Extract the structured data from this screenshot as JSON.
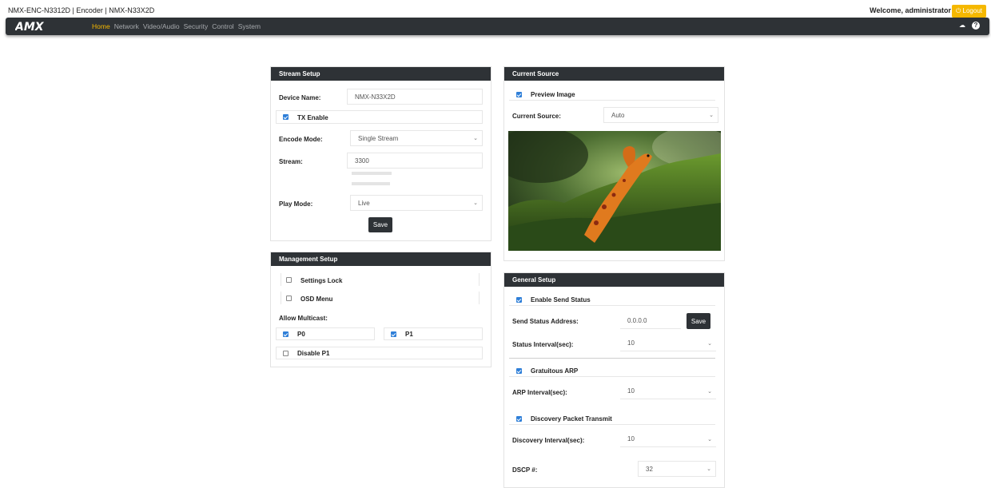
{
  "header": {
    "device_title": "NMX-ENC-N3312D | Encoder | NMX-N33X2D",
    "welcome": "Welcome, administrator",
    "logout_label": "Logout"
  },
  "nav": {
    "logo": "AMX",
    "items": [
      "Home",
      "Network",
      "Video/Audio",
      "Security",
      "Control",
      "System"
    ],
    "active": "Home"
  },
  "stream_setup": {
    "title": "Stream Setup",
    "device_name_label": "Device Name:",
    "device_name_value": "NMX-N33X2D",
    "tx_enable_label": "TX Enable",
    "tx_enable_checked": true,
    "encode_mode_label": "Encode Mode:",
    "encode_mode_value": "Single Stream",
    "stream_label": "Stream:",
    "stream_value": "3300",
    "play_mode_label": "Play Mode:",
    "play_mode_value": "Live",
    "save_label": "Save"
  },
  "management_setup": {
    "title": "Management Setup",
    "settings_lock_label": "Settings Lock",
    "settings_lock_checked": false,
    "osd_menu_label": "OSD Menu",
    "osd_menu_checked": false,
    "allow_multicast_label": "Allow Multicast:",
    "p0_label": "P0",
    "p0_checked": true,
    "p1_label": "P1",
    "p1_checked": true,
    "disable_p1_label": "Disable P1",
    "disable_p1_checked": false
  },
  "current_source": {
    "title": "Current Source",
    "preview_image_label": "Preview Image",
    "preview_image_checked": true,
    "current_source_label": "Current Source:",
    "current_source_value": "Auto"
  },
  "general_setup": {
    "title": "General Setup",
    "enable_send_status_label": "Enable Send Status",
    "enable_send_status_checked": true,
    "send_status_address_label": "Send Status Address:",
    "send_status_address_value": "0.0.0.0",
    "save_label": "Save",
    "status_interval_label": "Status Interval(sec):",
    "status_interval_value": "10",
    "gratuitous_arp_label": "Gratuitous ARP",
    "gratuitous_arp_checked": true,
    "arp_interval_label": "ARP Interval(sec):",
    "arp_interval_value": "10",
    "discovery_packet_label": "Discovery Packet Transmit",
    "discovery_packet_checked": true,
    "discovery_interval_label": "Discovery Interval(sec):",
    "discovery_interval_value": "10",
    "dscp_label": "DSCP #:",
    "dscp_value": "32"
  },
  "colors": {
    "accent": "#f5b800",
    "navbar": "#2e3236",
    "checkbox": "#2f7fd8"
  }
}
